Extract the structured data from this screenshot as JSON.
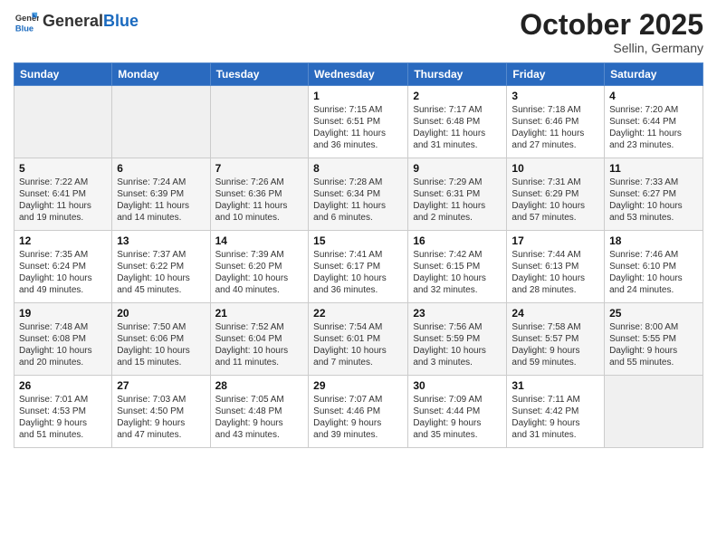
{
  "header": {
    "logo_general": "General",
    "logo_blue": "Blue",
    "month": "October 2025",
    "location": "Sellin, Germany"
  },
  "days_of_week": [
    "Sunday",
    "Monday",
    "Tuesday",
    "Wednesday",
    "Thursday",
    "Friday",
    "Saturday"
  ],
  "weeks": [
    [
      {
        "day": "",
        "info": ""
      },
      {
        "day": "",
        "info": ""
      },
      {
        "day": "",
        "info": ""
      },
      {
        "day": "1",
        "info": "Sunrise: 7:15 AM\nSunset: 6:51 PM\nDaylight: 11 hours\nand 36 minutes."
      },
      {
        "day": "2",
        "info": "Sunrise: 7:17 AM\nSunset: 6:48 PM\nDaylight: 11 hours\nand 31 minutes."
      },
      {
        "day": "3",
        "info": "Sunrise: 7:18 AM\nSunset: 6:46 PM\nDaylight: 11 hours\nand 27 minutes."
      },
      {
        "day": "4",
        "info": "Sunrise: 7:20 AM\nSunset: 6:44 PM\nDaylight: 11 hours\nand 23 minutes."
      }
    ],
    [
      {
        "day": "5",
        "info": "Sunrise: 7:22 AM\nSunset: 6:41 PM\nDaylight: 11 hours\nand 19 minutes."
      },
      {
        "day": "6",
        "info": "Sunrise: 7:24 AM\nSunset: 6:39 PM\nDaylight: 11 hours\nand 14 minutes."
      },
      {
        "day": "7",
        "info": "Sunrise: 7:26 AM\nSunset: 6:36 PM\nDaylight: 11 hours\nand 10 minutes."
      },
      {
        "day": "8",
        "info": "Sunrise: 7:28 AM\nSunset: 6:34 PM\nDaylight: 11 hours\nand 6 minutes."
      },
      {
        "day": "9",
        "info": "Sunrise: 7:29 AM\nSunset: 6:31 PM\nDaylight: 11 hours\nand 2 minutes."
      },
      {
        "day": "10",
        "info": "Sunrise: 7:31 AM\nSunset: 6:29 PM\nDaylight: 10 hours\nand 57 minutes."
      },
      {
        "day": "11",
        "info": "Sunrise: 7:33 AM\nSunset: 6:27 PM\nDaylight: 10 hours\nand 53 minutes."
      }
    ],
    [
      {
        "day": "12",
        "info": "Sunrise: 7:35 AM\nSunset: 6:24 PM\nDaylight: 10 hours\nand 49 minutes."
      },
      {
        "day": "13",
        "info": "Sunrise: 7:37 AM\nSunset: 6:22 PM\nDaylight: 10 hours\nand 45 minutes."
      },
      {
        "day": "14",
        "info": "Sunrise: 7:39 AM\nSunset: 6:20 PM\nDaylight: 10 hours\nand 40 minutes."
      },
      {
        "day": "15",
        "info": "Sunrise: 7:41 AM\nSunset: 6:17 PM\nDaylight: 10 hours\nand 36 minutes."
      },
      {
        "day": "16",
        "info": "Sunrise: 7:42 AM\nSunset: 6:15 PM\nDaylight: 10 hours\nand 32 minutes."
      },
      {
        "day": "17",
        "info": "Sunrise: 7:44 AM\nSunset: 6:13 PM\nDaylight: 10 hours\nand 28 minutes."
      },
      {
        "day": "18",
        "info": "Sunrise: 7:46 AM\nSunset: 6:10 PM\nDaylight: 10 hours\nand 24 minutes."
      }
    ],
    [
      {
        "day": "19",
        "info": "Sunrise: 7:48 AM\nSunset: 6:08 PM\nDaylight: 10 hours\nand 20 minutes."
      },
      {
        "day": "20",
        "info": "Sunrise: 7:50 AM\nSunset: 6:06 PM\nDaylight: 10 hours\nand 15 minutes."
      },
      {
        "day": "21",
        "info": "Sunrise: 7:52 AM\nSunset: 6:04 PM\nDaylight: 10 hours\nand 11 minutes."
      },
      {
        "day": "22",
        "info": "Sunrise: 7:54 AM\nSunset: 6:01 PM\nDaylight: 10 hours\nand 7 minutes."
      },
      {
        "day": "23",
        "info": "Sunrise: 7:56 AM\nSunset: 5:59 PM\nDaylight: 10 hours\nand 3 minutes."
      },
      {
        "day": "24",
        "info": "Sunrise: 7:58 AM\nSunset: 5:57 PM\nDaylight: 9 hours\nand 59 minutes."
      },
      {
        "day": "25",
        "info": "Sunrise: 8:00 AM\nSunset: 5:55 PM\nDaylight: 9 hours\nand 55 minutes."
      }
    ],
    [
      {
        "day": "26",
        "info": "Sunrise: 7:01 AM\nSunset: 4:53 PM\nDaylight: 9 hours\nand 51 minutes."
      },
      {
        "day": "27",
        "info": "Sunrise: 7:03 AM\nSunset: 4:50 PM\nDaylight: 9 hours\nand 47 minutes."
      },
      {
        "day": "28",
        "info": "Sunrise: 7:05 AM\nSunset: 4:48 PM\nDaylight: 9 hours\nand 43 minutes."
      },
      {
        "day": "29",
        "info": "Sunrise: 7:07 AM\nSunset: 4:46 PM\nDaylight: 9 hours\nand 39 minutes."
      },
      {
        "day": "30",
        "info": "Sunrise: 7:09 AM\nSunset: 4:44 PM\nDaylight: 9 hours\nand 35 minutes."
      },
      {
        "day": "31",
        "info": "Sunrise: 7:11 AM\nSunset: 4:42 PM\nDaylight: 9 hours\nand 31 minutes."
      },
      {
        "day": "",
        "info": ""
      }
    ]
  ]
}
